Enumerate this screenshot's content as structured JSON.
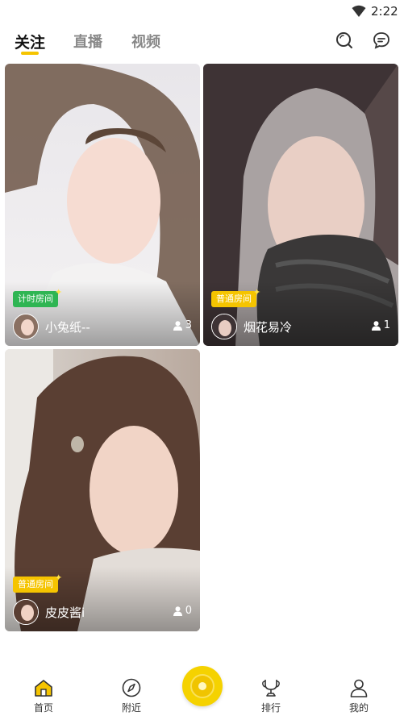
{
  "status_bar": {
    "time": "2:22",
    "icons": [
      "wifi-icon"
    ]
  },
  "top_nav": {
    "tabs": [
      {
        "label": "关注",
        "active": true
      },
      {
        "label": "直播",
        "active": false
      },
      {
        "label": "视频",
        "active": false
      }
    ],
    "icons": [
      "search-icon",
      "message-icon"
    ],
    "accent_color": "#f5c400"
  },
  "cards": [
    {
      "badge": "计时房间",
      "badge_color": "#2fb553",
      "name": "小兔纸--",
      "viewers": "3"
    },
    {
      "badge": "普通房间",
      "badge_color": "#f5c400",
      "name": "烟花易冷",
      "viewers": "1"
    },
    {
      "badge": "普通房间",
      "badge_color": "#f5c400",
      "name": "皮皮酱i",
      "viewers": "0"
    }
  ],
  "bottom_nav": {
    "items": [
      {
        "label": "首页",
        "icon": "home-icon",
        "active": true
      },
      {
        "label": "附近",
        "icon": "compass-icon",
        "active": false
      },
      {
        "label": "",
        "icon": "live-record-icon",
        "active": false
      },
      {
        "label": "排行",
        "icon": "trophy-icon",
        "active": false
      },
      {
        "label": "我的",
        "icon": "profile-icon",
        "active": false
      }
    ]
  }
}
